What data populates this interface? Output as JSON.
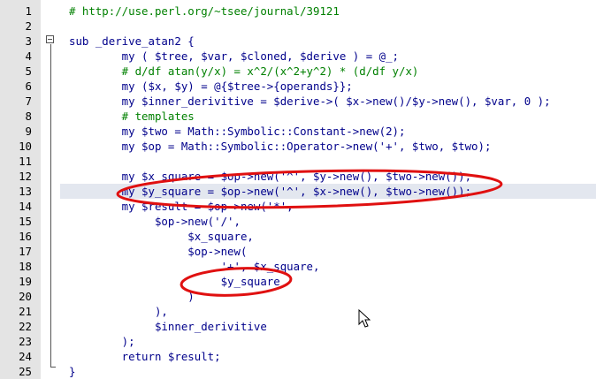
{
  "editor": {
    "lines": [
      {
        "num": "1",
        "tokens": [
          {
            "t": "# http://use.perl.org/~tsee/journal/39121",
            "c": "c"
          }
        ]
      },
      {
        "num": "2",
        "tokens": []
      },
      {
        "num": "3",
        "tokens": [
          {
            "t": "sub _derive_atan2 {",
            "c": "k"
          }
        ]
      },
      {
        "num": "4",
        "tokens": [
          {
            "t": "        my ( $tree, $var, $cloned, $derive ) = @_;",
            "c": "v"
          }
        ]
      },
      {
        "num": "5",
        "tokens": [
          {
            "t": "        # d/df atan(y/x) = x^2/(x^2+y^2) * (d/df y/x)",
            "c": "c"
          }
        ]
      },
      {
        "num": "6",
        "tokens": [
          {
            "t": "        my ($x, $y) = @{$tree->{operands}};",
            "c": "v"
          }
        ]
      },
      {
        "num": "7",
        "tokens": [
          {
            "t": "        my $inner_derivitive = $derive->( $x->new()/$y->new(), $var, 0 );",
            "c": "v"
          }
        ]
      },
      {
        "num": "8",
        "tokens": [
          {
            "t": "        # templates",
            "c": "c"
          }
        ]
      },
      {
        "num": "9",
        "tokens": [
          {
            "t": "        my $two = Math::Symbolic::Constant->new(2);",
            "c": "v"
          }
        ]
      },
      {
        "num": "10",
        "tokens": [
          {
            "t": "        my $op = Math::Symbolic::Operator->new('+', $two, $two);",
            "c": "v"
          }
        ]
      },
      {
        "num": "11",
        "tokens": []
      },
      {
        "num": "12",
        "tokens": [
          {
            "t": "        my $x_square = $op->new('^', $y->new(), $two->new());",
            "c": "v"
          }
        ]
      },
      {
        "num": "13",
        "tokens": [
          {
            "t": "        my $y_square = $op->new('^', $x->new(), $two->new());",
            "c": "v"
          }
        ]
      },
      {
        "num": "14",
        "tokens": [
          {
            "t": "        my $result = $op->new('*',",
            "c": "v"
          }
        ]
      },
      {
        "num": "15",
        "tokens": [
          {
            "t": "             $op->new('/',",
            "c": "v"
          }
        ]
      },
      {
        "num": "16",
        "tokens": [
          {
            "t": "                  $x_square,",
            "c": "v"
          }
        ]
      },
      {
        "num": "17",
        "tokens": [
          {
            "t": "                  $op->new(",
            "c": "v"
          }
        ]
      },
      {
        "num": "18",
        "tokens": [
          {
            "t": "                       '+', $x_square,",
            "c": "v"
          }
        ]
      },
      {
        "num": "19",
        "tokens": [
          {
            "t": "                       $y_square",
            "c": "v"
          }
        ]
      },
      {
        "num": "20",
        "tokens": [
          {
            "t": "                  )",
            "c": "v"
          }
        ]
      },
      {
        "num": "21",
        "tokens": [
          {
            "t": "             ),",
            "c": "v"
          }
        ]
      },
      {
        "num": "22",
        "tokens": [
          {
            "t": "             $inner_derivitive",
            "c": "v"
          }
        ]
      },
      {
        "num": "23",
        "tokens": [
          {
            "t": "        );",
            "c": "v"
          }
        ]
      },
      {
        "num": "24",
        "tokens": [
          {
            "t": "        return $result;",
            "c": "v"
          }
        ]
      },
      {
        "num": "25",
        "tokens": [
          {
            "t": "}",
            "c": "k"
          }
        ]
      }
    ],
    "current_line": 13,
    "colors": {
      "gutter": "#e4e4e4",
      "current_line": "#e3e7ef",
      "comment": "#008000",
      "code": "#00008b",
      "annotation": "#e01010"
    }
  }
}
